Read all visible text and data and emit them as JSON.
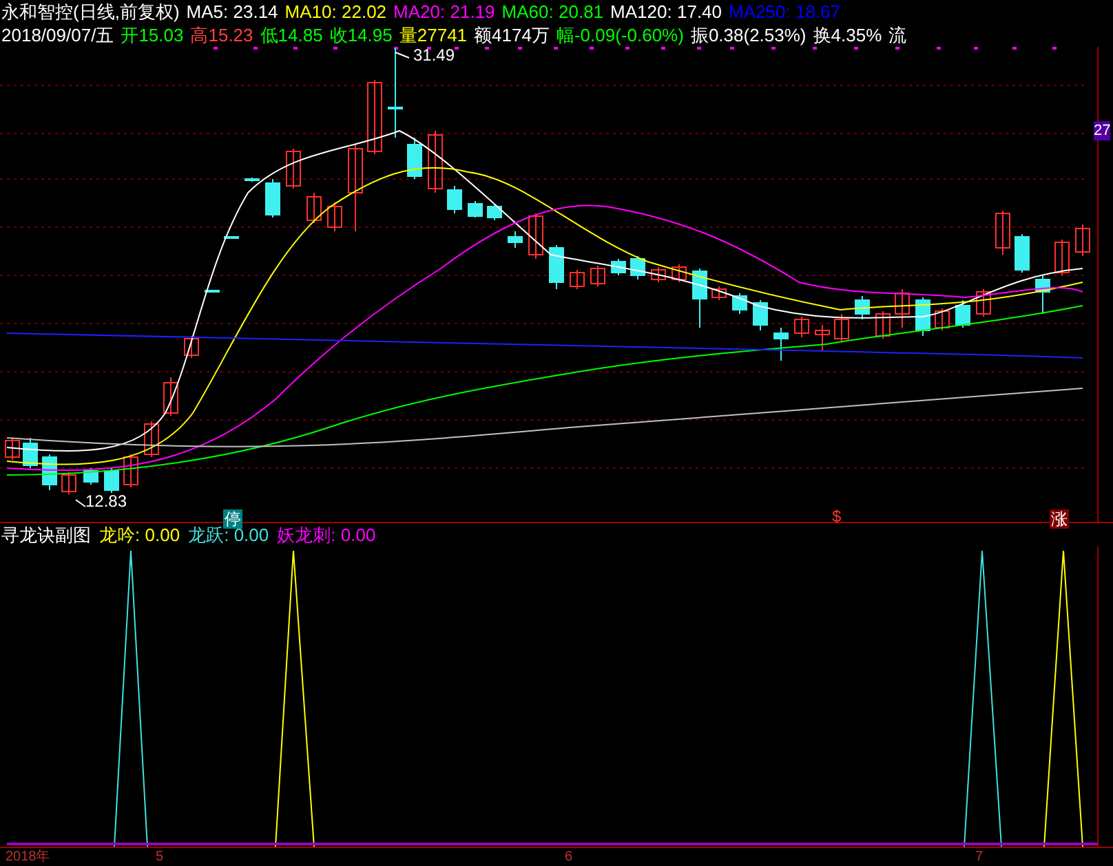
{
  "title": "永和智控(日线,前复权)",
  "moving_averages": [
    {
      "label": "MA5:",
      "value": "23.14",
      "color": "#ffffff"
    },
    {
      "label": "MA10:",
      "value": "22.02",
      "color": "#ffff00"
    },
    {
      "label": "MA20:",
      "value": "21.19",
      "color": "#ff00ff"
    },
    {
      "label": "MA60:",
      "value": "20.81",
      "color": "#00ff00"
    },
    {
      "label": "MA120:",
      "value": "17.40",
      "color": "#ffffff"
    },
    {
      "label": "MA250:",
      "value": "18.67",
      "color": "#0000ff"
    }
  ],
  "date": "2018/09/07/五",
  "quote": [
    {
      "label": "开",
      "value": "15.03",
      "color": "#00ff00"
    },
    {
      "label": "高",
      "value": "15.23",
      "color": "#ff4040"
    },
    {
      "label": "低",
      "value": "14.85",
      "color": "#00ff00"
    },
    {
      "label": "收",
      "value": "14.95",
      "color": "#00ff00"
    },
    {
      "label": "量",
      "value": "27741",
      "color": "#ffff00"
    },
    {
      "label": "额",
      "value": "4174万",
      "color": "#ffffff"
    },
    {
      "label": "幅",
      "value": "-0.09(-0.60%)",
      "color": "#00ff00"
    },
    {
      "label": "振",
      "value": "0.38(2.53%)",
      "color": "#ffffff"
    },
    {
      "label": "换",
      "value": "4.35%",
      "color": "#ffffff"
    },
    {
      "label": "流",
      "color": "#ffffff"
    }
  ],
  "main_chart": {
    "high_label": "31.49",
    "low_label": "12.83",
    "price_axis_label": "27",
    "markers": [
      {
        "kind": "badge",
        "text": "停",
        "color": "#008080"
      },
      {
        "kind": "sign",
        "text": "$",
        "color": "#ff3030"
      },
      {
        "kind": "badge",
        "text": "涨",
        "color": "#800000"
      }
    ]
  },
  "sub_chart": {
    "title": "寻龙诀副图",
    "indicators": [
      {
        "label": "龙吟:",
        "value": "0.00",
        "color": "#ffff00"
      },
      {
        "label": "龙跃:",
        "value": "0.00",
        "color": "#40e0e0"
      },
      {
        "label": "妖龙刺:",
        "value": "0.00",
        "color": "#ff00ff"
      }
    ]
  },
  "time_axis": [
    "2018年",
    "5",
    "6",
    "7"
  ]
}
